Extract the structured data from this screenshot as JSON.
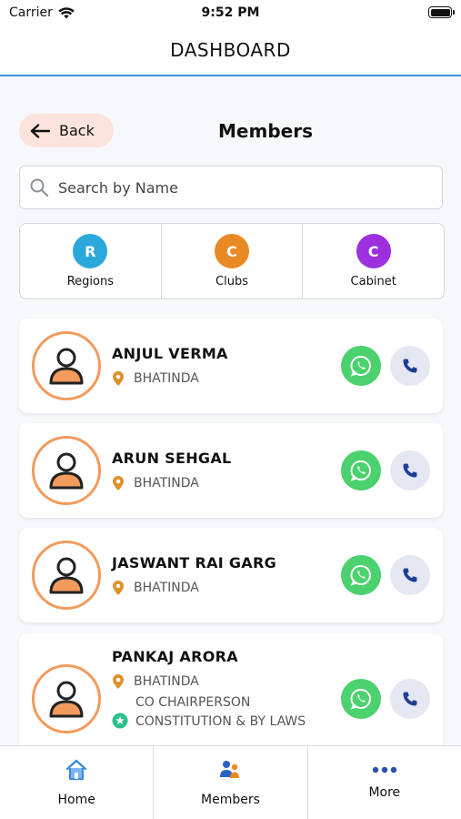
{
  "status_bar": {
    "carrier": "Carrier",
    "time": "9:52 PM"
  },
  "header": {
    "title": "DASHBOARD"
  },
  "sub_header": {
    "back_label": "Back",
    "page_title": "Members"
  },
  "search": {
    "placeholder": "Search by Name",
    "value": ""
  },
  "categories": [
    {
      "letter": "R",
      "label": "Regions",
      "color": "#2aa8dc"
    },
    {
      "letter": "C",
      "label": "Clubs",
      "color": "#e98a24"
    },
    {
      "letter": "C",
      "label": "Cabinet",
      "color": "#9b30dc"
    }
  ],
  "members": [
    {
      "name": "ANJUL VERMA",
      "location": "BHATINDA"
    },
    {
      "name": "ARUN SEHGAL",
      "location": "BHATINDA"
    },
    {
      "name": "JASWANT RAI GARG",
      "location": "BHATINDA"
    },
    {
      "name": "PANKAJ ARORA",
      "location": "BHATINDA",
      "role": "CO CHAIRPERSON CONSTITUTION & BY LAWS"
    }
  ],
  "bottom_nav": [
    {
      "label": "Home",
      "icon": "home-icon"
    },
    {
      "label": "Members",
      "icon": "members-icon"
    },
    {
      "label": "More",
      "icon": "more-dots-icon"
    }
  ],
  "colors": {
    "accent_blue": "#4a8fe0",
    "avatar_orange": "#f29b5d",
    "whatsapp_green": "#4bd16d",
    "location_pin": "#e0902a",
    "role_star": "#2bbf8a",
    "call_blue": "#1f3f94",
    "back_bg": "#fce3dc"
  }
}
